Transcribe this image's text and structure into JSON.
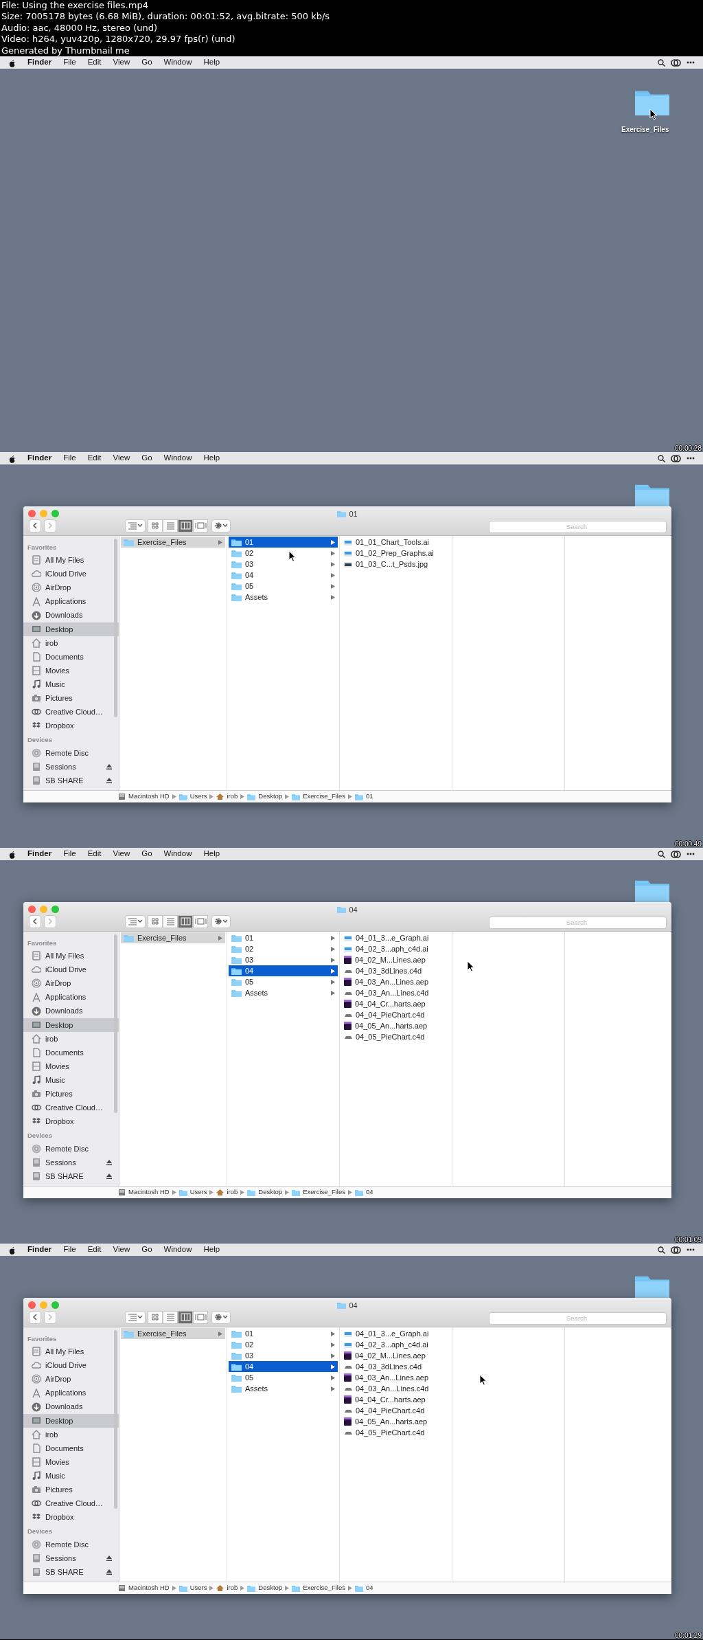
{
  "header": [
    "File: Using the exercise files.mp4",
    "Size: 7005178 bytes (6.68 MiB), duration: 00:01:52, avg.bitrate: 500 kb/s",
    "Audio: aac, 48000 Hz, stereo (und)",
    "Video: h264, yuv420p, 1280x720, 29.97 fps(r) (und)",
    "Generated by Thumbnail me"
  ],
  "frames": [
    {
      "menu_bar": {
        "app": "Finder",
        "menus": [
          "File",
          "Edit",
          "View",
          "Go",
          "Window",
          "Help"
        ]
      },
      "desktop_label": "Exercise_Files",
      "timestamp": "00:00:28"
    },
    {
      "menu_bar": {
        "app": "Finder",
        "menus": [
          "File",
          "Edit",
          "View",
          "Go",
          "Window",
          "Help"
        ]
      },
      "timestamp": "00:00:49",
      "finder": {
        "title": "01",
        "search": {
          "placeholder": "Search"
        },
        "views": [
          {
            "selected": false
          },
          {
            "selected": false
          },
          {
            "selected": true
          },
          {
            "selected": false
          }
        ],
        "sidebar": [
          {
            "heading": "Favorites",
            "items": [
              {
                "label": "All My Files",
                "selected": false
              },
              {
                "label": "iCloud Drive",
                "selected": false
              },
              {
                "label": "AirDrop",
                "selected": false
              },
              {
                "label": "Applications",
                "selected": false
              },
              {
                "label": "Downloads",
                "selected": false
              },
              {
                "label": "Desktop",
                "selected": true
              },
              {
                "label": "irob",
                "selected": false
              },
              {
                "label": "Documents",
                "selected": false
              },
              {
                "label": "Movies",
                "selected": false
              },
              {
                "label": "Music",
                "selected": false
              },
              {
                "label": "Pictures",
                "selected": false
              },
              {
                "label": "Creative Cloud…",
                "selected": false
              },
              {
                "label": "Dropbox",
                "selected": false
              }
            ]
          },
          {
            "heading": "Devices",
            "items": [
              {
                "label": "Remote Disc",
                "selected": false,
                "eject": false
              },
              {
                "label": "Sessions",
                "selected": false,
                "eject": true
              },
              {
                "label": "SB SHARE",
                "selected": false,
                "eject": true
              }
            ]
          }
        ],
        "columns": [
          {
            "items": [
              {
                "label": "Exercise_Files",
                "kind": "folder",
                "selected": true
              }
            ]
          },
          {
            "items": [
              {
                "label": "01",
                "kind": "folder",
                "selected": true
              },
              {
                "label": "02",
                "kind": "folder",
                "selected": false
              },
              {
                "label": "03",
                "kind": "folder",
                "selected": false
              },
              {
                "label": "04",
                "kind": "folder",
                "selected": false
              },
              {
                "label": "05",
                "kind": "folder",
                "selected": false
              },
              {
                "label": "Assets",
                "kind": "folder",
                "selected": false
              }
            ]
          },
          {
            "items": [
              {
                "label": "01_01_Chart_Tools.ai",
                "kind": "ai",
                "selected": false
              },
              {
                "label": "01_02_Prep_Graphs.ai",
                "kind": "ai",
                "selected": false
              },
              {
                "label": "01_03_C...t_Psds.jpg",
                "kind": "jpg",
                "selected": false
              }
            ]
          }
        ],
        "path": [
          {
            "label": "Macintosh HD",
            "kind": "drive"
          },
          {
            "label": "Users",
            "kind": "folder"
          },
          {
            "label": "irob",
            "kind": "home"
          },
          {
            "label": "Desktop",
            "kind": "folder"
          },
          {
            "label": "Exercise_Files",
            "kind": "folder"
          },
          {
            "label": "01",
            "kind": "folder"
          }
        ]
      }
    },
    {
      "menu_bar": {
        "app": "Finder",
        "menus": [
          "File",
          "Edit",
          "View",
          "Go",
          "Window",
          "Help"
        ]
      },
      "timestamp": "00:01:09",
      "finder": {
        "title": "04",
        "search": {
          "placeholder": "Search"
        },
        "views": [
          {
            "selected": false
          },
          {
            "selected": false
          },
          {
            "selected": true
          },
          {
            "selected": false
          }
        ],
        "sidebar": [
          {
            "heading": "Favorites",
            "items": [
              {
                "label": "All My Files",
                "selected": false
              },
              {
                "label": "iCloud Drive",
                "selected": false
              },
              {
                "label": "AirDrop",
                "selected": false
              },
              {
                "label": "Applications",
                "selected": false
              },
              {
                "label": "Downloads",
                "selected": false
              },
              {
                "label": "Desktop",
                "selected": true
              },
              {
                "label": "irob",
                "selected": false
              },
              {
                "label": "Documents",
                "selected": false
              },
              {
                "label": "Movies",
                "selected": false
              },
              {
                "label": "Music",
                "selected": false
              },
              {
                "label": "Pictures",
                "selected": false
              },
              {
                "label": "Creative Cloud…",
                "selected": false
              },
              {
                "label": "Dropbox",
                "selected": false
              }
            ]
          },
          {
            "heading": "Devices",
            "items": [
              {
                "label": "Remote Disc",
                "selected": false,
                "eject": false
              },
              {
                "label": "Sessions",
                "selected": false,
                "eject": true
              },
              {
                "label": "SB SHARE",
                "selected": false,
                "eject": true
              }
            ]
          }
        ],
        "columns": [
          {
            "items": [
              {
                "label": "Exercise_Files",
                "kind": "folder",
                "selected": true
              }
            ]
          },
          {
            "items": [
              {
                "label": "01",
                "kind": "folder",
                "selected": false
              },
              {
                "label": "02",
                "kind": "folder",
                "selected": false
              },
              {
                "label": "03",
                "kind": "folder",
                "selected": false
              },
              {
                "label": "04",
                "kind": "folder",
                "selected": true
              },
              {
                "label": "05",
                "kind": "folder",
                "selected": false
              },
              {
                "label": "Assets",
                "kind": "folder",
                "selected": false
              }
            ]
          },
          {
            "items": [
              {
                "label": "04_01_3...e_Graph.ai",
                "kind": "ai",
                "selected": false
              },
              {
                "label": "04_02_3...aph_c4d.ai",
                "kind": "ai",
                "selected": false
              },
              {
                "label": "04_02_M...Lines.aep",
                "kind": "aep",
                "selected": false
              },
              {
                "label": "04_03_3dLines.c4d",
                "kind": "c4d",
                "selected": false
              },
              {
                "label": "04_03_An...Lines.aep",
                "kind": "aep",
                "selected": false
              },
              {
                "label": "04_03_An...Lines.c4d",
                "kind": "c4d",
                "selected": false
              },
              {
                "label": "04_04_Cr...harts.aep",
                "kind": "aep",
                "selected": false
              },
              {
                "label": "04_04_PieChart.c4d",
                "kind": "c4d",
                "selected": false
              },
              {
                "label": "04_05_An...harts.aep",
                "kind": "aep",
                "selected": false
              },
              {
                "label": "04_05_PieChart.c4d",
                "kind": "c4d",
                "selected": false
              }
            ]
          }
        ],
        "path": [
          {
            "label": "Macintosh HD",
            "kind": "drive"
          },
          {
            "label": "Users",
            "kind": "folder"
          },
          {
            "label": "irob",
            "kind": "home"
          },
          {
            "label": "Desktop",
            "kind": "folder"
          },
          {
            "label": "Exercise_Files",
            "kind": "folder"
          },
          {
            "label": "04",
            "kind": "folder"
          }
        ]
      }
    },
    {
      "menu_bar": {
        "app": "Finder",
        "menus": [
          "File",
          "Edit",
          "View",
          "Go",
          "Window",
          "Help"
        ]
      },
      "timestamp": "00:01:29",
      "finder": {
        "title": "04",
        "search": {
          "placeholder": "Search"
        },
        "views": [
          {
            "selected": false
          },
          {
            "selected": false
          },
          {
            "selected": true
          },
          {
            "selected": false
          }
        ],
        "sidebar": [
          {
            "heading": "Favorites",
            "items": [
              {
                "label": "All My Files",
                "selected": false
              },
              {
                "label": "iCloud Drive",
                "selected": false
              },
              {
                "label": "AirDrop",
                "selected": false
              },
              {
                "label": "Applications",
                "selected": false
              },
              {
                "label": "Downloads",
                "selected": false
              },
              {
                "label": "Desktop",
                "selected": true
              },
              {
                "label": "irob",
                "selected": false
              },
              {
                "label": "Documents",
                "selected": false
              },
              {
                "label": "Movies",
                "selected": false
              },
              {
                "label": "Music",
                "selected": false
              },
              {
                "label": "Pictures",
                "selected": false
              },
              {
                "label": "Creative Cloud…",
                "selected": false
              },
              {
                "label": "Dropbox",
                "selected": false
              }
            ]
          },
          {
            "heading": "Devices",
            "items": [
              {
                "label": "Remote Disc",
                "selected": false,
                "eject": false
              },
              {
                "label": "Sessions",
                "selected": false,
                "eject": true
              },
              {
                "label": "SB SHARE",
                "selected": false,
                "eject": true
              }
            ]
          }
        ],
        "columns": [
          {
            "items": [
              {
                "label": "Exercise_Files",
                "kind": "folder",
                "selected": true
              }
            ]
          },
          {
            "items": [
              {
                "label": "01",
                "kind": "folder",
                "selected": false
              },
              {
                "label": "02",
                "kind": "folder",
                "selected": false
              },
              {
                "label": "03",
                "kind": "folder",
                "selected": false
              },
              {
                "label": "04",
                "kind": "folder",
                "selected": true
              },
              {
                "label": "05",
                "kind": "folder",
                "selected": false
              },
              {
                "label": "Assets",
                "kind": "folder",
                "selected": false
              }
            ]
          },
          {
            "items": [
              {
                "label": "04_01_3...e_Graph.ai",
                "kind": "ai",
                "selected": false
              },
              {
                "label": "04_02_3...aph_c4d.ai",
                "kind": "ai",
                "selected": false
              },
              {
                "label": "04_02_M...Lines.aep",
                "kind": "aep",
                "selected": false
              },
              {
                "label": "04_03_3dLines.c4d",
                "kind": "c4d",
                "selected": false
              },
              {
                "label": "04_03_An...Lines.aep",
                "kind": "aep",
                "selected": false
              },
              {
                "label": "04_03_An...Lines.c4d",
                "kind": "c4d",
                "selected": false
              },
              {
                "label": "04_04_Cr...harts.aep",
                "kind": "aep",
                "selected": false
              },
              {
                "label": "04_04_PieChart.c4d",
                "kind": "c4d",
                "selected": false
              },
              {
                "label": "04_05_An...harts.aep",
                "kind": "aep",
                "selected": false
              },
              {
                "label": "04_05_PieChart.c4d",
                "kind": "c4d",
                "selected": false
              }
            ]
          }
        ],
        "path": [
          {
            "label": "Macintosh HD",
            "kind": "drive"
          },
          {
            "label": "Users",
            "kind": "folder"
          },
          {
            "label": "irob",
            "kind": "home"
          },
          {
            "label": "Desktop",
            "kind": "folder"
          },
          {
            "label": "Exercise_Files",
            "kind": "folder"
          },
          {
            "label": "04",
            "kind": "folder"
          }
        ]
      }
    }
  ]
}
